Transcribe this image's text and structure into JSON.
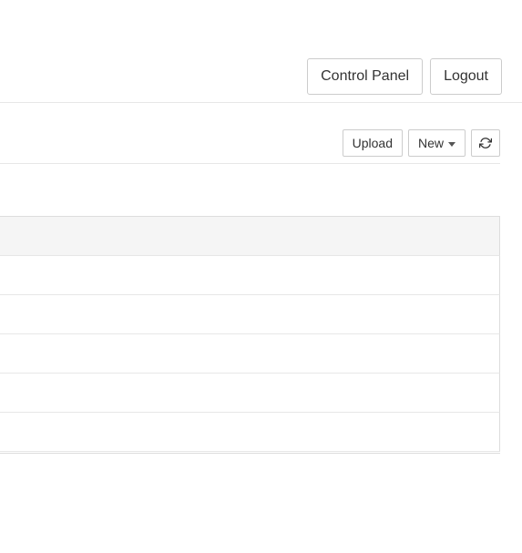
{
  "topnav": {
    "control_panel": "Control Panel",
    "logout": "Logout"
  },
  "toolbar": {
    "upload": "Upload",
    "new": "New"
  },
  "table": {
    "rows": [
      "",
      "",
      "",
      "",
      ""
    ]
  }
}
